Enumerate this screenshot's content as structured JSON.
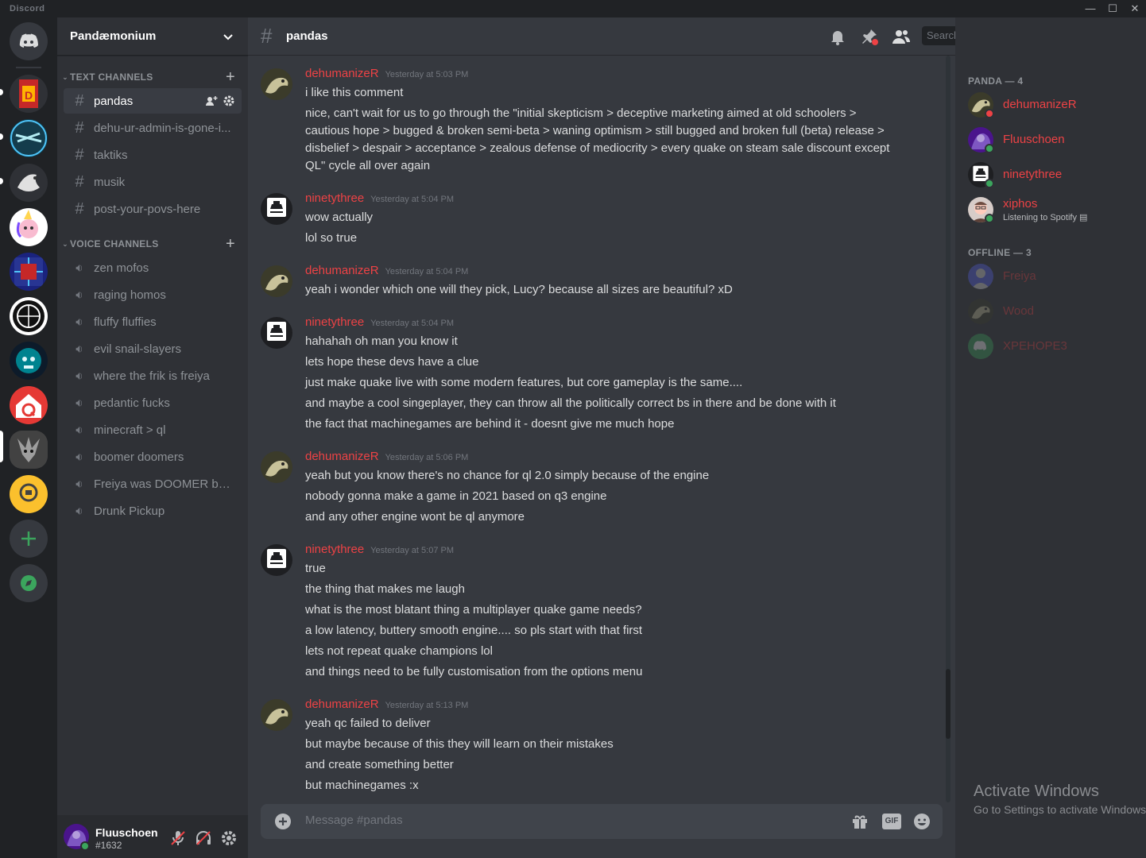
{
  "titlebar": {
    "brand": "Discord",
    "minimize": "—",
    "maximize": "☐",
    "close": "✕"
  },
  "server": {
    "name": "Pandæmonium"
  },
  "categories": {
    "text": "TEXT CHANNELS",
    "voice": "VOICE CHANNELS"
  },
  "text_channels": [
    "pandas",
    "dehu-ur-admin-is-gone-i...",
    "taktiks",
    "musik",
    "post-your-povs-here"
  ],
  "voice_channels": [
    "zen mofos",
    "raging homos",
    "fluffy fluffies",
    "evil snail-slayers",
    "where the frik is freiya",
    "pedantic fucks",
    "minecraft > ql",
    "boomer doomers",
    "Freiya was DOOMER bef...",
    "Drunk Pickup"
  ],
  "user": {
    "name": "Fluuschoen",
    "tag": "#1632"
  },
  "channel": {
    "title": "pandas",
    "search_placeholder": "Search"
  },
  "messages": [
    {
      "author": "dehumanizeR",
      "time": "Yesterday at 5:03 PM",
      "avatar": "lizard",
      "lines": [
        "i like this comment",
        "nice, can't wait for us to go through the \"initial skepticism > deceptive marketing aimed at old schoolers >",
        "cautious hope > bugged & broken semi-beta > waning optimism > still bugged and broken full (beta) release >",
        "disbelief > despair > acceptance > zealous defense of mediocrity > every quake on steam sale discount except",
        "QL\" cycle all over again"
      ]
    },
    {
      "author": "ninetythree",
      "time": "Yesterday at 5:04 PM",
      "avatar": "badge",
      "lines": [
        "wow actually",
        "lol so true"
      ]
    },
    {
      "author": "dehumanizeR",
      "time": "Yesterday at 5:04 PM",
      "avatar": "lizard",
      "lines": [
        "yeah i wonder which one will they pick, Lucy? because all sizes are beautiful? xD"
      ]
    },
    {
      "author": "ninetythree",
      "time": "Yesterday at 5:04 PM",
      "avatar": "badge",
      "lines": [
        "hahahah oh man you know it",
        "lets hope these devs have a clue",
        "just make quake live with some modern features, but core gameplay is the same....",
        "and maybe a cool singeplayer, they can throw all the politically correct bs in there and be done with it",
        "the fact that machinegames are behind it - doesnt give me much hope"
      ]
    },
    {
      "author": "dehumanizeR",
      "time": "Yesterday at 5:06 PM",
      "avatar": "lizard",
      "lines": [
        "yeah but you know there's no chance for ql 2.0 simply because of the engine",
        "nobody gonna make a game in 2021 based on q3 engine",
        "and any other engine wont be ql anymore"
      ]
    },
    {
      "author": "ninetythree",
      "time": "Yesterday at 5:07 PM",
      "avatar": "badge",
      "lines": [
        "true",
        "the thing that makes me laugh",
        "what is the most blatant thing a multiplayer quake game needs?",
        "a low latency, buttery smooth engine.... so pls start with that first",
        "lets not repeat quake champions lol",
        "and things need to be fully customisation from the options menu"
      ]
    },
    {
      "author": "dehumanizeR",
      "time": "Yesterday at 5:13 PM",
      "avatar": "lizard",
      "lines": [
        "yeah qc failed to deliver",
        "but maybe because of this they will learn on their mistakes",
        "and create something better",
        "but machinegames :x"
      ]
    }
  ],
  "composer": {
    "placeholder": "Message #pandas",
    "gif_label": "GIF"
  },
  "members": {
    "online_header": "PANDA — 4",
    "offline_header": "OFFLINE — 3",
    "online": [
      {
        "name": "dehumanizeR",
        "status": "dnd",
        "activity": ""
      },
      {
        "name": "Fluuschoen",
        "status": "online",
        "activity": ""
      },
      {
        "name": "ninetythree",
        "status": "online",
        "activity": ""
      },
      {
        "name": "xiphos",
        "status": "online",
        "activity": "Listening to Spotify"
      }
    ],
    "offline": [
      {
        "name": "Freiya"
      },
      {
        "name": "Wood"
      },
      {
        "name": "XPEHOPE3"
      }
    ]
  },
  "watermark": {
    "line1": "Activate Windows",
    "line2": "Go to Settings to activate Windows."
  },
  "colors": {
    "accent": "#ed4245",
    "online": "#3ba55d",
    "dnd": "#ed4245",
    "blurple": "#5865f2"
  }
}
